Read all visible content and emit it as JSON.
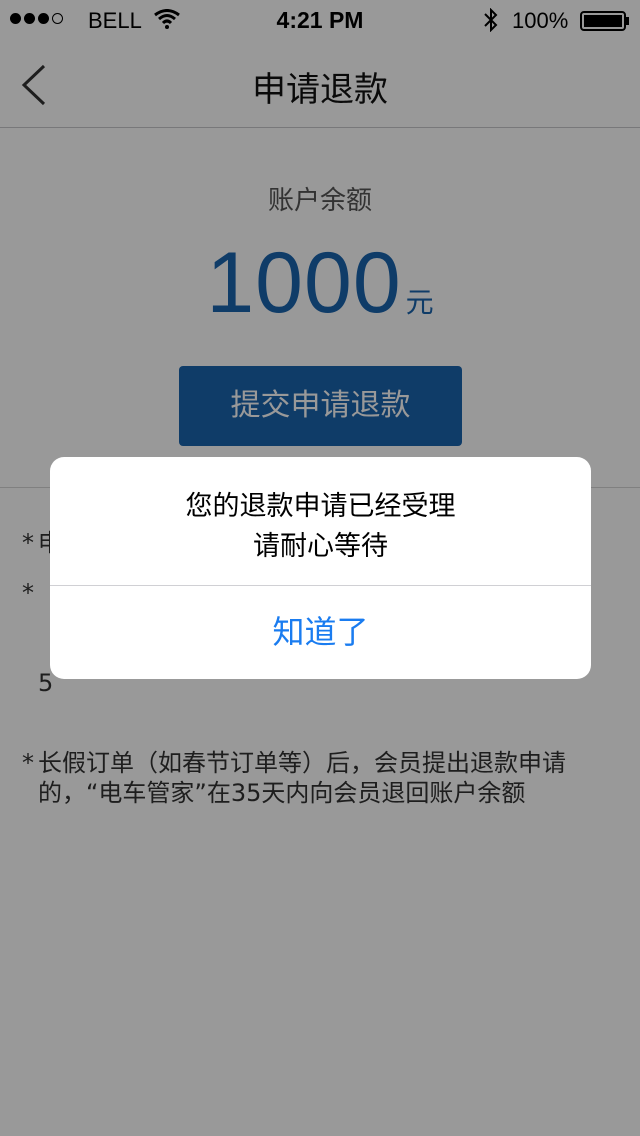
{
  "status_bar": {
    "carrier": "BELL",
    "time": "4:21 PM",
    "battery": "100%"
  },
  "nav": {
    "title": "申请退款"
  },
  "account": {
    "balance_label": "账户余额",
    "balance_amount": "1000",
    "balance_unit": "元"
  },
  "actions": {
    "submit_label": "提交申请退款"
  },
  "notes": [
    {
      "bullet": "*",
      "text": "申"
    },
    {
      "bullet": "*",
      "text": "提                                                       01\n5"
    },
    {
      "bullet": "*",
      "text": "长假订单（如春节订单等）后，会员提出退款申请的，“电车管家”在35天内向会员退回账户余额"
    }
  ],
  "alert": {
    "line1": "您的退款申请已经受理",
    "line2": "请耐心等待",
    "button_label": "知道了"
  },
  "colors": {
    "accent": "#1a64ae",
    "alert_button": "#1a7cf0",
    "overlay": "rgba(0,0,0,0.4)"
  },
  "icons": [
    "signal-icon",
    "wifi-icon",
    "bluetooth-icon",
    "battery-icon",
    "back-chevron-icon"
  ]
}
